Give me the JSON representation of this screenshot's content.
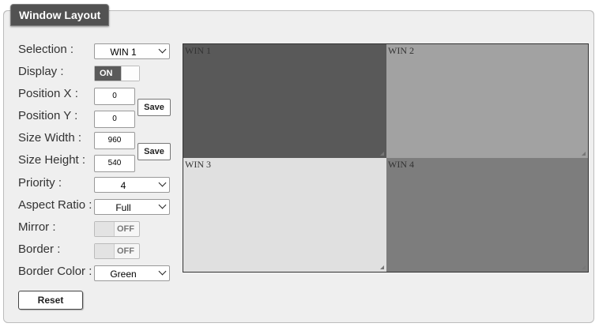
{
  "panel": {
    "title": "Window Layout"
  },
  "form": {
    "selection": {
      "label": "Selection :",
      "value": "WIN 1"
    },
    "display": {
      "label": "Display :",
      "state": "ON"
    },
    "position_x": {
      "label": "Position X :",
      "value": "0"
    },
    "position_y": {
      "label": "Position Y :",
      "value": "0"
    },
    "position_save_label": "Save",
    "size_width": {
      "label": "Size Width :",
      "value": "960"
    },
    "size_height": {
      "label": "Size Height :",
      "value": "540"
    },
    "size_save_label": "Save",
    "priority": {
      "label": "Priority :",
      "value": "4"
    },
    "aspect_ratio": {
      "label": "Aspect Ratio :",
      "value": "Full"
    },
    "mirror": {
      "label": "Mirror :",
      "state": "OFF"
    },
    "border": {
      "label": "Border :",
      "state": "OFF"
    },
    "border_color": {
      "label": "Border Color :",
      "value": "Green"
    },
    "reset_label": "Reset"
  },
  "windows": [
    {
      "label": "WIN 1",
      "color": "#595959"
    },
    {
      "label": "WIN 2",
      "color": "#a2a2a2"
    },
    {
      "label": "WIN 3",
      "color": "#e0e0e0"
    },
    {
      "label": "WIN 4",
      "color": "#7d7d7d"
    }
  ]
}
